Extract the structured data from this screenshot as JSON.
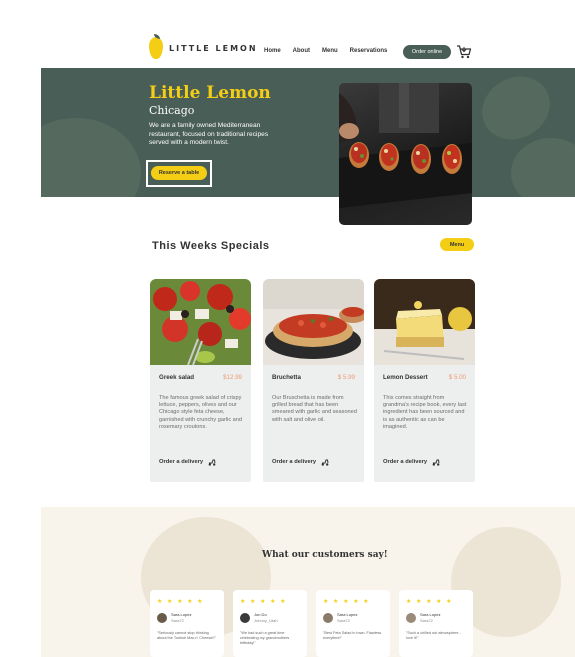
{
  "header": {
    "logo_text": "LITTLE LEMON",
    "nav": [
      "Home",
      "About",
      "Menu",
      "Reservations"
    ],
    "order_online": "Order online",
    "cart_icon": "cart-icon"
  },
  "hero": {
    "title": "Little Lemon",
    "subtitle": "Chicago",
    "description": "We are a family owned Mediterranean restaurant, focused on traditional recipes served with a modern twist.",
    "reserve_label": "Reserve a table"
  },
  "specials": {
    "title": "This Weeks Specials",
    "menu_label": "Menu",
    "cards": [
      {
        "name": "Greek salad",
        "price": "$12.99",
        "description": "The famous greek salad of crispy lettuce, peppers, olives and our Chicago style feta cheese, garnished with crunchy garlic and rosemary croutons.",
        "order_label": "Order a delivery"
      },
      {
        "name": "Bruchetta",
        "price": "$ 5.99",
        "description": "Our Bruschetta is made from grilled bread that has been smeared with garlic and seasoned with salt and olive oil.",
        "order_label": "Order a delivery"
      },
      {
        "name": "Lemon Dessert",
        "price": "$ 5.00",
        "description": "This comes straight from grandma's recipe book, every last ingredient has been sourced and is as authentic as can be imagined.",
        "order_label": "Order a delivery"
      }
    ]
  },
  "testimonials": {
    "title": "What our customers say!",
    "stars": "★ ★ ★ ★ ★",
    "reviews": [
      {
        "name": "Sara Lopez",
        "handle": "Sara72",
        "quote": "\"Seriously cannot stop thinking about the Turkish Mac n' Cheese!!\""
      },
      {
        "name": "Jon Do",
        "handle": "Johnny_Utah",
        "quote": "\"We had such a great time celebrating my grandmothers bitthday!\""
      },
      {
        "name": "Sara Lopez",
        "handle": "Sara72",
        "quote": "\"Best Feta Salad in town. Flawless everytime!\""
      },
      {
        "name": "Sara Lopez",
        "handle": "Sara72",
        "quote": "\"Such a chilled out atmosphere - love it!\""
      }
    ]
  },
  "colors": {
    "primary_green": "#495e57",
    "primary_yellow": "#f4ce14",
    "card_bg": "#edefee",
    "price": "#ee9972",
    "testimonial_bg": "#f8f4ec"
  }
}
